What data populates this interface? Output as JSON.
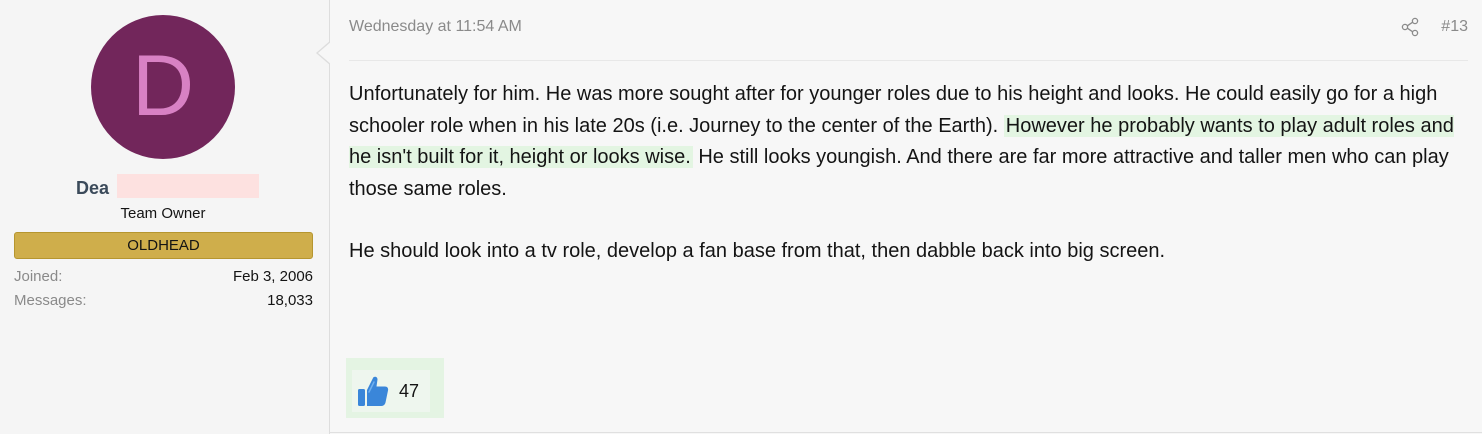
{
  "user": {
    "avatar_letter": "D",
    "avatar_color": "#72265b",
    "avatar_letter_color": "#d881c4",
    "username_visible": "Dea",
    "title": "Team Owner",
    "banner": "OLDHEAD",
    "banner_color": "#cfae4b",
    "stats": {
      "joined_label": "Joined:",
      "joined_value": "Feb 3, 2006",
      "messages_label": "Messages:",
      "messages_value": "18,033"
    }
  },
  "post": {
    "date": "Wednesday at 11:54 AM",
    "number": "#13",
    "share_icon": "share-icon",
    "body": {
      "p1_part1": "Unfortunately for him. He was more sought after for younger roles due to his height and looks. He could easily go for a high schooler role when in his late 20s (i.e. Journey to the center of the Earth). ",
      "p1_highlight": "However he probably wants to play adult roles and he isn't built for it, height or looks wise.",
      "p1_part2": " He still looks youngish. And there are far more attractive and taller men who can play those same roles.",
      "p2": "He should look into a tv role, develop a fan base from that, then dabble back into big screen."
    },
    "highlight_color": "#e3f5e2",
    "reactions": {
      "icon": "thumbs-up-icon",
      "count": "47",
      "icon_color": "#3a86d9"
    }
  }
}
